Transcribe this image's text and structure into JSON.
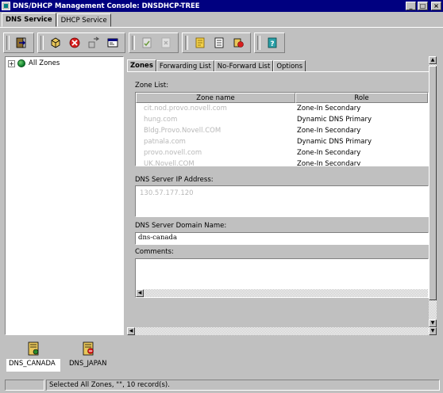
{
  "window": {
    "title": "DNS/DHCP Management Console: DNSDHCP-TREE",
    "minimize_glyph": "_",
    "maximize_glyph": "□",
    "close_glyph": "×"
  },
  "service_tabs": [
    {
      "label": "DNS Service",
      "active": true
    },
    {
      "label": "DHCP Service",
      "active": false
    }
  ],
  "toolbar": {
    "groups": [
      [
        "exit-icon"
      ],
      [
        "create-icon",
        "delete-icon",
        "import-icon",
        "view-icon"
      ],
      [
        "save-icon",
        "cancel-icon"
      ],
      [
        "start-server-icon",
        "stop-server-icon",
        "server-action-icon"
      ],
      [
        "help-icon"
      ]
    ]
  },
  "tree": {
    "expander": "+",
    "root_label": "All Zones"
  },
  "detail": {
    "tabs": [
      {
        "label": "Zones",
        "active": true
      },
      {
        "label": "Forwarding List",
        "active": false
      },
      {
        "label": "No-Forward List",
        "active": false
      },
      {
        "label": "Options",
        "active": false
      }
    ],
    "zone_list_label": "Zone List:",
    "columns": {
      "name": "Zone name",
      "role": "Role"
    },
    "zones": [
      {
        "name": "cit.nod.provo.novell.com",
        "role": "Zone-In Secondary"
      },
      {
        "name": "hung.com",
        "role": "Dynamic DNS Primary"
      },
      {
        "name": "Bldg.Provo.Novell.COM",
        "role": "Zone-In Secondary"
      },
      {
        "name": "patnala.com",
        "role": "Dynamic DNS Primary"
      },
      {
        "name": "provo.novell.com",
        "role": "Zone-In Secondary"
      },
      {
        "name": "UK.Novell.COM",
        "role": "Zone-In Secondary"
      }
    ],
    "ip_label": "DNS Server IP Address:",
    "ip_entries": [
      "130.57.177.120"
    ],
    "domain_label": "DNS Server Domain Name:",
    "domain_value": "dns-canada",
    "comments_label": "Comments:",
    "comments_value": ""
  },
  "servers": [
    {
      "name": "DNS_CANADA",
      "selected": true,
      "status": "running"
    },
    {
      "name": "DNS_JAPAN",
      "selected": false,
      "status": "stopped"
    }
  ],
  "statusbar": {
    "left": "",
    "message": "Selected All Zones, \"\", 10 record(s)."
  },
  "colors": {
    "titlebar": "#000080",
    "face": "#c0c0c0",
    "disabled_text": "#b8b8b8"
  }
}
